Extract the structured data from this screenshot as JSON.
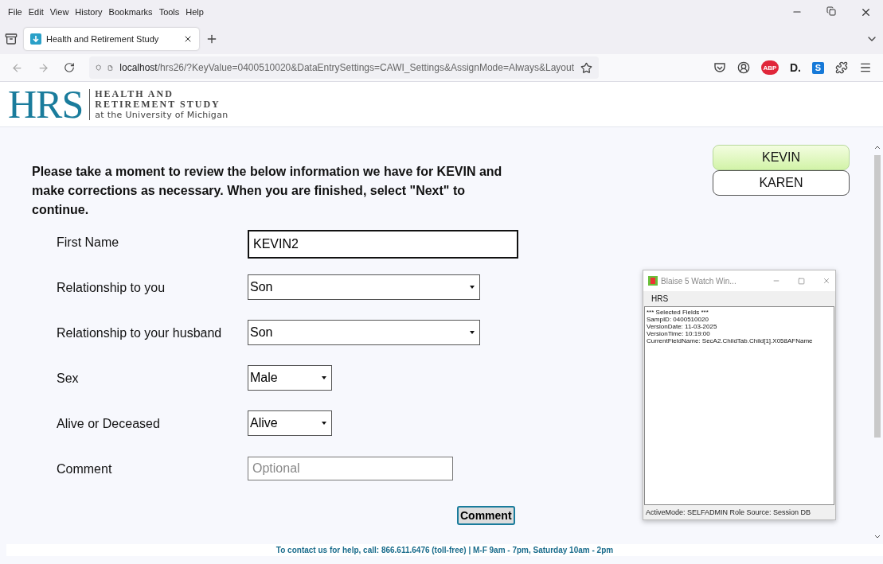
{
  "menu_bar": [
    "File",
    "Edit",
    "View",
    "History",
    "Bookmarks",
    "Tools",
    "Help"
  ],
  "tabs": [
    {
      "title": "Health and Retirement Study",
      "selected": true
    }
  ],
  "address_bar": {
    "host": "localhost",
    "path": "/hrs26/?KeyValue=0400510020&DataEntrySettings=CAWI_Settings&AssignMode=Always&Layout"
  },
  "extensions": [
    {
      "kind": "pocket"
    },
    {
      "kind": "account"
    },
    {
      "kind": "abp",
      "label": "ABP"
    },
    {
      "kind": "d",
      "label": "D."
    },
    {
      "kind": "s",
      "label": "S"
    },
    {
      "kind": "puzzle"
    },
    {
      "kind": "menu"
    }
  ],
  "header": {
    "logo": "HRS",
    "line_1": "HEALTH AND",
    "line_2": "RETIREMENT STUDY",
    "line_3": "at the University of Michigan"
  },
  "people": [
    {
      "name": "KEVIN",
      "selected": true
    },
    {
      "name": "KAREN",
      "selected": false
    }
  ],
  "instructions": "Please take a moment to review the below information we have for KEVIN and make corrections as necessary. When you are finished, select \"Next\" to continue.",
  "fields": [
    {
      "kind": "text",
      "label": "First Name",
      "value": "KEVIN2",
      "focused": true
    },
    {
      "kind": "select",
      "label": "Relationship to you",
      "value": "Son",
      "wide": true
    },
    {
      "kind": "select",
      "label": "Relationship to your husband",
      "value": "Son",
      "wide": true
    },
    {
      "kind": "select",
      "label": "Sex",
      "value": "Male",
      "wide": false
    },
    {
      "kind": "select",
      "label": "Alive or Deceased",
      "value": "Alive",
      "wide": false
    },
    {
      "kind": "text",
      "label": "Comment",
      "placeholder": "Optional",
      "focused": false
    }
  ],
  "comment_button": "Comment",
  "footer": "To contact us for help, call: 866.611.6476 (toll-free) | M-F 9am - 7pm, Saturday 10am - 2pm",
  "watch_window": {
    "title": "Blaise 5 Watch Win...",
    "menu": "HRS",
    "lines": [
      "*** Selected Fields ***",
      "SampID: 0400510020",
      "VersionDate: 11-03-2025",
      "VersionTime: 10:19:00",
      "CurrentFieldName: SecA2.ChildTab.Child[1].X058AFName"
    ],
    "status": "ActiveMode: SELFADMIN Role Source: Session DB"
  }
}
